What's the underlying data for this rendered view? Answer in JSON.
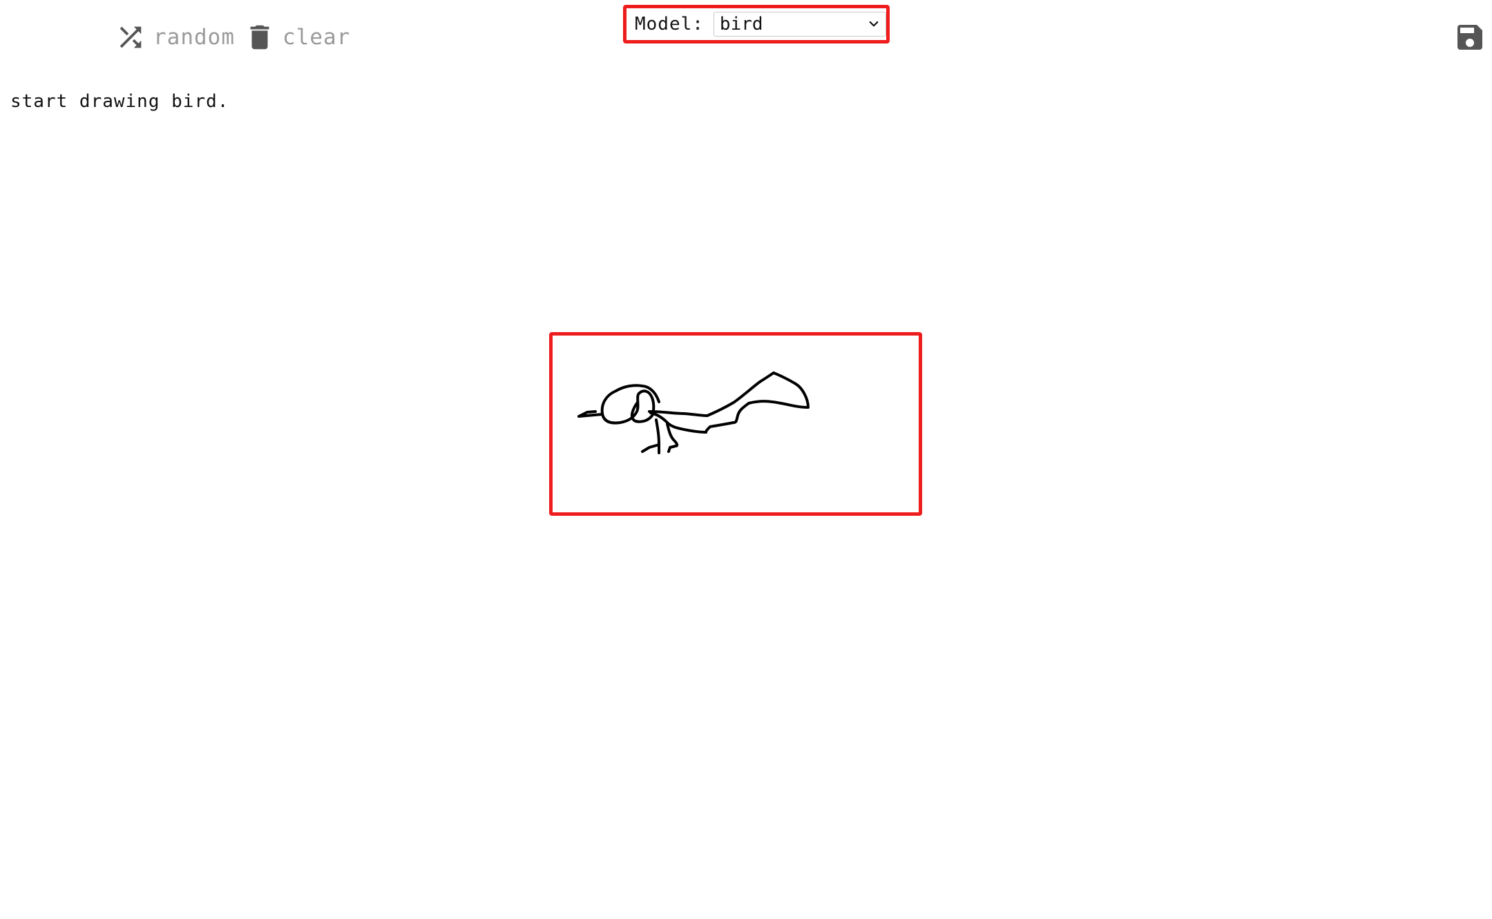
{
  "toolbar": {
    "random_label": "random",
    "clear_label": "clear",
    "random_icon": "shuffle-icon",
    "clear_icon": "trash-icon",
    "save_icon": "save-icon"
  },
  "model": {
    "label": "Model:",
    "selected": "bird",
    "options": [
      "bird"
    ]
  },
  "status": {
    "message": "start drawing bird."
  },
  "colors": {
    "highlight": "#ee1c1c",
    "toolbar_text": "#9a9a9a",
    "icon": "#555555",
    "stroke": "#000000"
  }
}
